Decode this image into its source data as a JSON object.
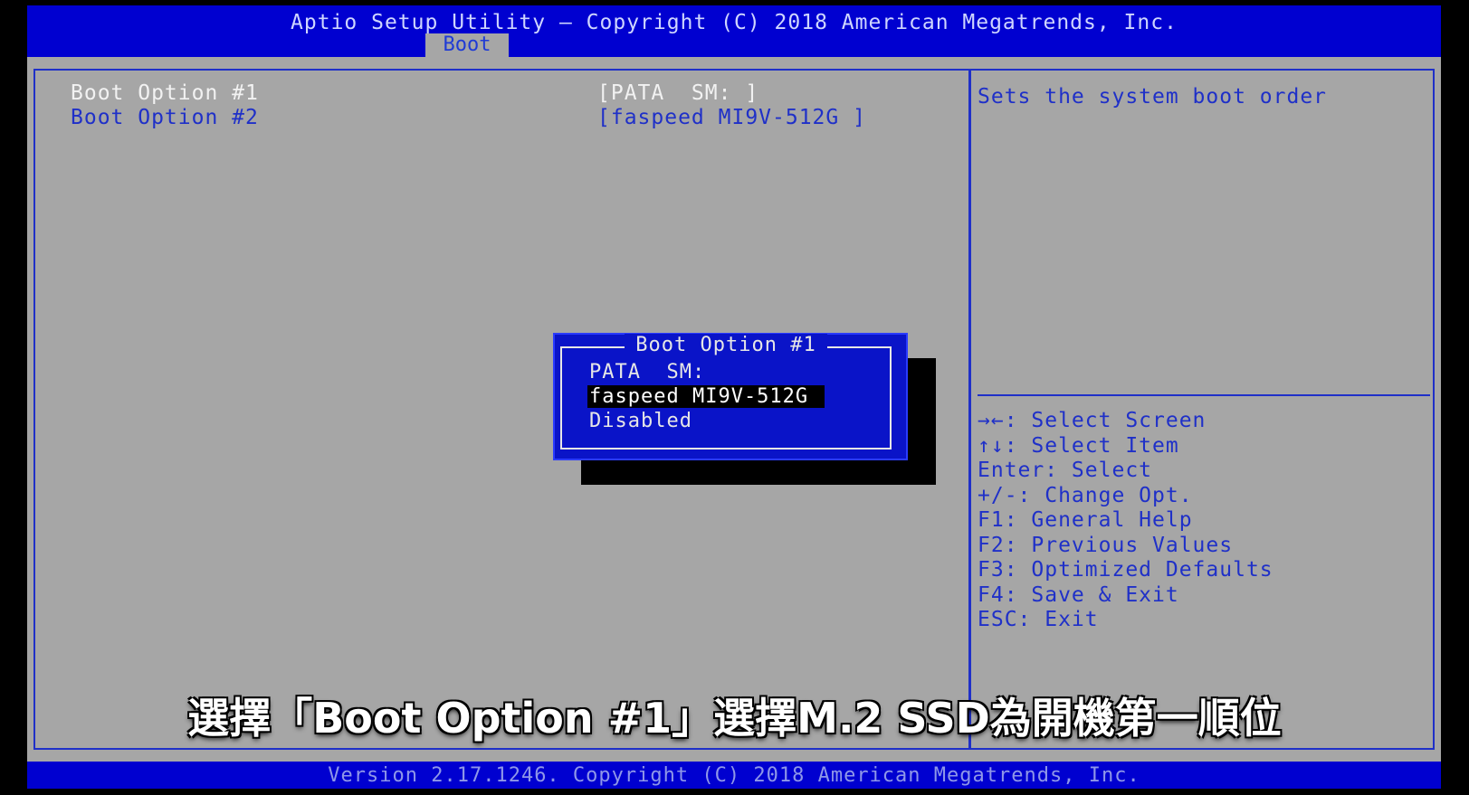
{
  "header": {
    "title": "Aptio Setup Utility – Copyright (C) 2018 American Megatrends, Inc.",
    "active_tab": "Boot"
  },
  "options": [
    {
      "label": "Boot Option #1",
      "value": "[PATA  SM: ]"
    },
    {
      "label": "Boot Option #2",
      "value": "[faspeed MI9V-512G ]"
    }
  ],
  "help": {
    "description": "Sets the system boot order",
    "keys": [
      "→←: Select Screen",
      "↑↓: Select Item",
      "Enter: Select",
      "+/-: Change Opt.",
      "F1: General Help",
      "F2: Previous Values",
      "F3: Optimized Defaults",
      "F4: Save & Exit",
      "ESC: Exit"
    ]
  },
  "popup": {
    "title": "Boot Option #1",
    "items": [
      "PATA  SM:",
      "faspeed MI9V-512G",
      "Disabled"
    ],
    "selected_index": 1
  },
  "footer": {
    "text": "Version 2.17.1246. Copyright (C) 2018 American Megatrends, Inc."
  },
  "subtitle": "選擇「Boot Option #1」選擇M.2 SSD為開機第一順位",
  "colors": {
    "bios_blue": "#0000d0",
    "bios_gray": "#a6a6a6",
    "text_blue": "#1f30c8",
    "text_white": "#e6e6e6"
  }
}
